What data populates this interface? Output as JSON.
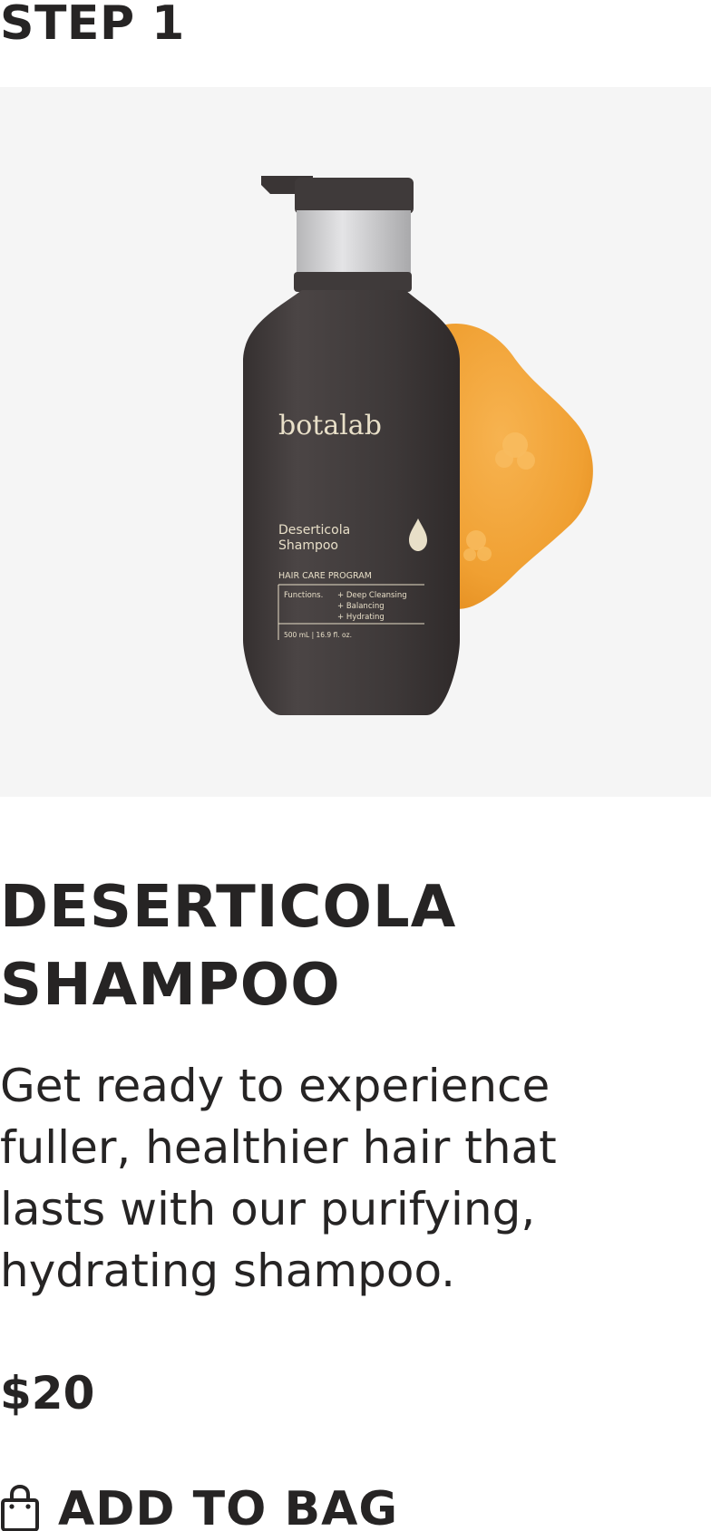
{
  "step": {
    "label": "STEP 1"
  },
  "product": {
    "image_alt": "Deserticola Shampoo bottle with orange gel swatch",
    "bottle_label": {
      "brand": "botalab",
      "name_line1": "Deserticola",
      "name_line2": "Shampoo",
      "program": "HAIR CARE PROGRAM",
      "functions_heading": "Functions.",
      "function_1": "+ Deep Cleansing",
      "function_2": "+ Balancing",
      "function_3": "+ Hydrating",
      "volume": "500 mL | 16.9 fl. oz."
    },
    "title": "DESERTICOLA SHAMPOO",
    "description": "Get ready to experience fuller, healthier hair that lasts with our purifying, hydrating shampoo.",
    "price": "$20"
  },
  "actions": {
    "add_to_bag_label": "ADD TO BAG",
    "add_to_bag_icon": "shopping-bag-icon"
  },
  "colors": {
    "text": "#262424",
    "hero_background": "#f5f5f5",
    "bottle": "#3f3a3a",
    "gel": "#f2a23a"
  }
}
